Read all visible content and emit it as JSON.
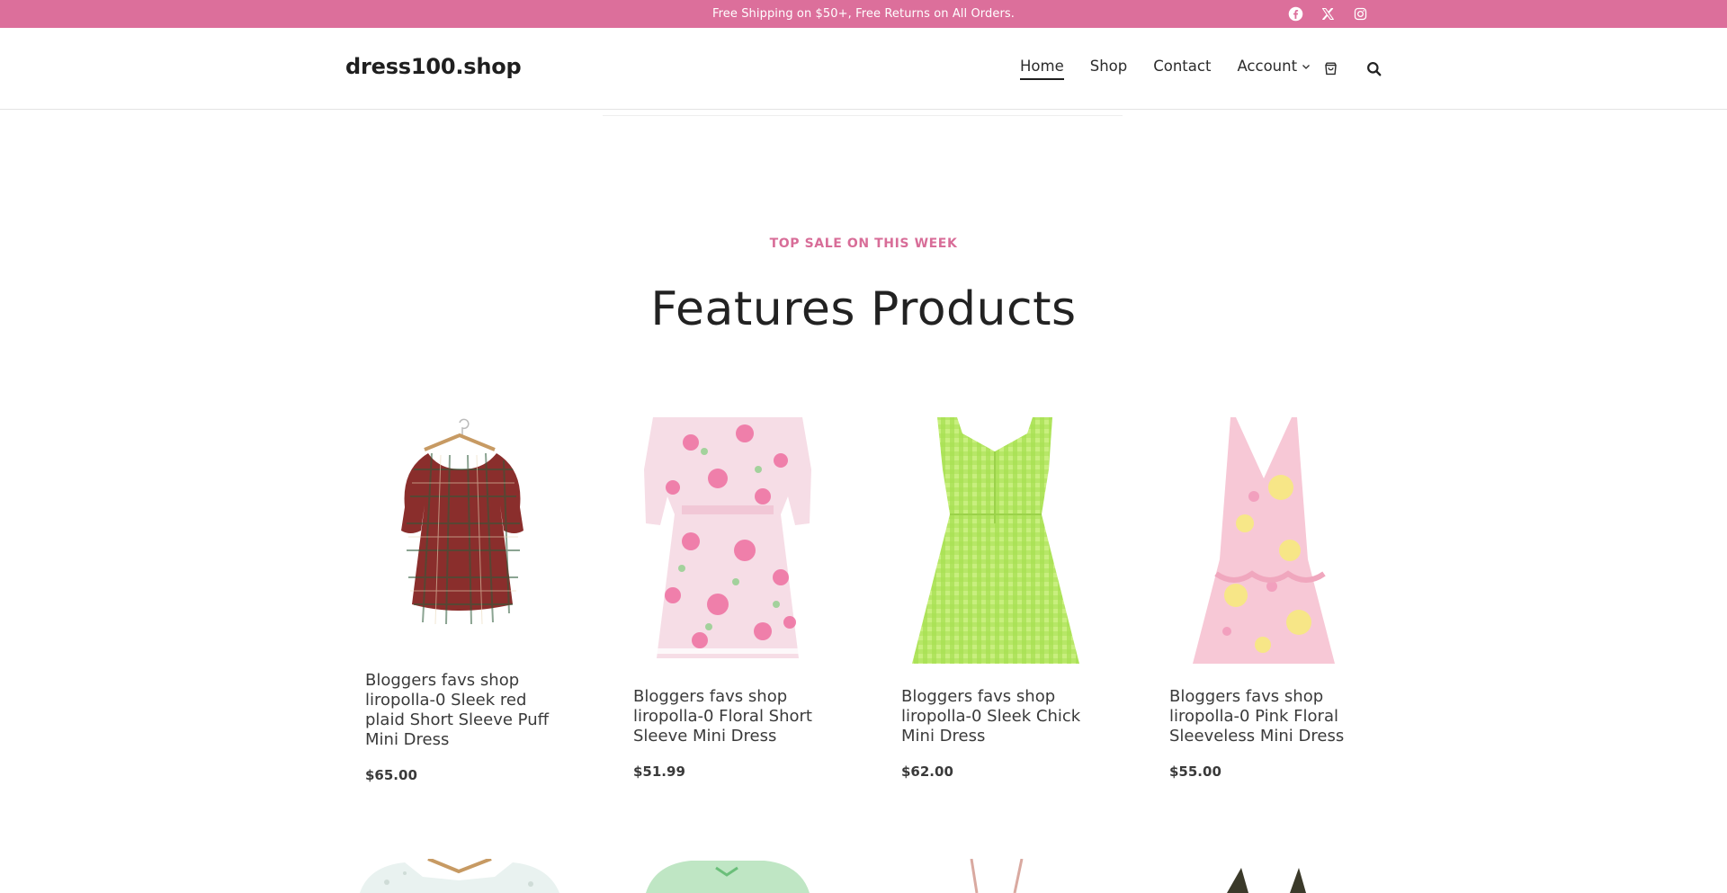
{
  "topbar": {
    "promo": "Free Shipping on $50+, Free Returns on All Orders.",
    "social": [
      {
        "icon": "facebook-icon"
      },
      {
        "icon": "x-twitter-icon"
      },
      {
        "icon": "instagram-icon"
      }
    ]
  },
  "header": {
    "logo": "dress100.shop",
    "nav": [
      {
        "label": "Home",
        "active": true
      },
      {
        "label": "Shop"
      },
      {
        "label": "Contact"
      },
      {
        "label": "Account"
      }
    ],
    "cart_icon": "cart-icon",
    "search_icon": "search-icon"
  },
  "section": {
    "eyebrow": "TOP SALE ON THIS WEEK",
    "title": "Features Products"
  },
  "products": [
    {
      "name": "Bloggers favs shop liropolla-0 Sleek red plaid Short Sleeve Puff Mini Dress",
      "price": "$65.00"
    },
    {
      "name": "Bloggers favs shop liropolla-0 Floral Short Sleeve Mini Dress",
      "price": "$51.99"
    },
    {
      "name": "Bloggers favs shop liropolla-0 Sleek Chick Mini Dress",
      "price": "$62.00"
    },
    {
      "name": "Bloggers favs shop liropolla-0 Pink Floral Sleeveless Mini Dress",
      "price": "$55.00"
    }
  ],
  "colors": {
    "accent": "#dc6f9b",
    "eyebrow": "#d86d98",
    "text": "#222222"
  }
}
